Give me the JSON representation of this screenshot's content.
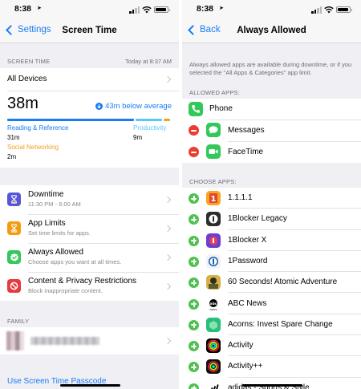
{
  "status_bar": {
    "time": "8:38",
    "location_arrow": "location-arrow-icon"
  },
  "left": {
    "nav": {
      "back_label": "Settings",
      "title": "Screen Time"
    },
    "screen_time_section": {
      "header": "SCREEN TIME",
      "timestamp": "Today at 8:37 AM"
    },
    "devices_row": {
      "label": "All Devices"
    },
    "usage": {
      "total": "38m",
      "below_average": "43m below average",
      "bar_fractions": {
        "reading_reference": 0.82,
        "productivity": 0.18,
        "social_networking": 0.05
      },
      "categories": [
        {
          "name": "Reading & Reference",
          "value": "31m",
          "color": "#1a7cf5"
        },
        {
          "name": "Productivity",
          "value": "9m",
          "color": "#5ac8fa"
        },
        {
          "name": "Social Networking",
          "value": "2m",
          "color": "#f0a124"
        }
      ]
    },
    "settings_rows": [
      {
        "title": "Downtime",
        "subtitle": "11:30 PM - 6:00 AM",
        "icon": "moon-hourglass-icon",
        "color": "#5856d6"
      },
      {
        "title": "App Limits",
        "subtitle": "Set time limits for apps.",
        "icon": "hourglass-icon",
        "color": "#f39c12"
      },
      {
        "title": "Always Allowed",
        "subtitle": "Choose apps you want at all times.",
        "icon": "checkmark-badge-icon",
        "color": "#34c759"
      },
      {
        "title": "Content & Privacy Restrictions",
        "subtitle": "Block inappropriate content.",
        "icon": "restriction-icon",
        "color": "#e8393c"
      }
    ],
    "family_section": {
      "header": "FAMILY"
    },
    "passcode_link": "Use Screen Time Passcode"
  },
  "right": {
    "nav": {
      "back_label": "Back",
      "title": "Always Allowed"
    },
    "info_text": "Always allowed apps are available during downtime, or if you selected the \"All Apps & Categories\" app limit.",
    "allowed_header": "ALLOWED APPS:",
    "allowed_apps": [
      {
        "name": "Phone",
        "removable": false,
        "icon": "phone-icon",
        "color": "#34c759"
      },
      {
        "name": "Messages",
        "removable": true,
        "icon": "messages-icon",
        "color": "#34c759"
      },
      {
        "name": "FaceTime",
        "removable": true,
        "icon": "facetime-icon",
        "color": "#34c759"
      }
    ],
    "choose_header": "CHOOSE APPS:",
    "choose_apps": [
      {
        "name": "1.1.1.1",
        "icon": "1111-app-icon",
        "color": "#f38020"
      },
      {
        "name": "1Blocker Legacy",
        "icon": "1blocker-legacy-icon",
        "color": "#222222"
      },
      {
        "name": "1Blocker X",
        "icon": "1blocker-x-icon",
        "color": "#7a3fd1"
      },
      {
        "name": "1Password",
        "icon": "1password-icon",
        "color": "#1a5fb4"
      },
      {
        "name": "60 Seconds! Atomic Adventure",
        "icon": "60-seconds-icon",
        "color": "#6b6b2a"
      },
      {
        "name": "ABC News",
        "icon": "abc-news-icon",
        "color": "#000000"
      },
      {
        "name": "Acorns: Invest Spare Change",
        "icon": "acorns-icon",
        "color": "#2ecc71"
      },
      {
        "name": "Activity",
        "icon": "activity-rings-icon",
        "color": "#000000"
      },
      {
        "name": "Activity++",
        "icon": "activity-plus-icon",
        "color": "#111111"
      },
      {
        "name": "adidas - Sports & Style",
        "icon": "adidas-icon",
        "color": "#000000"
      }
    ]
  }
}
